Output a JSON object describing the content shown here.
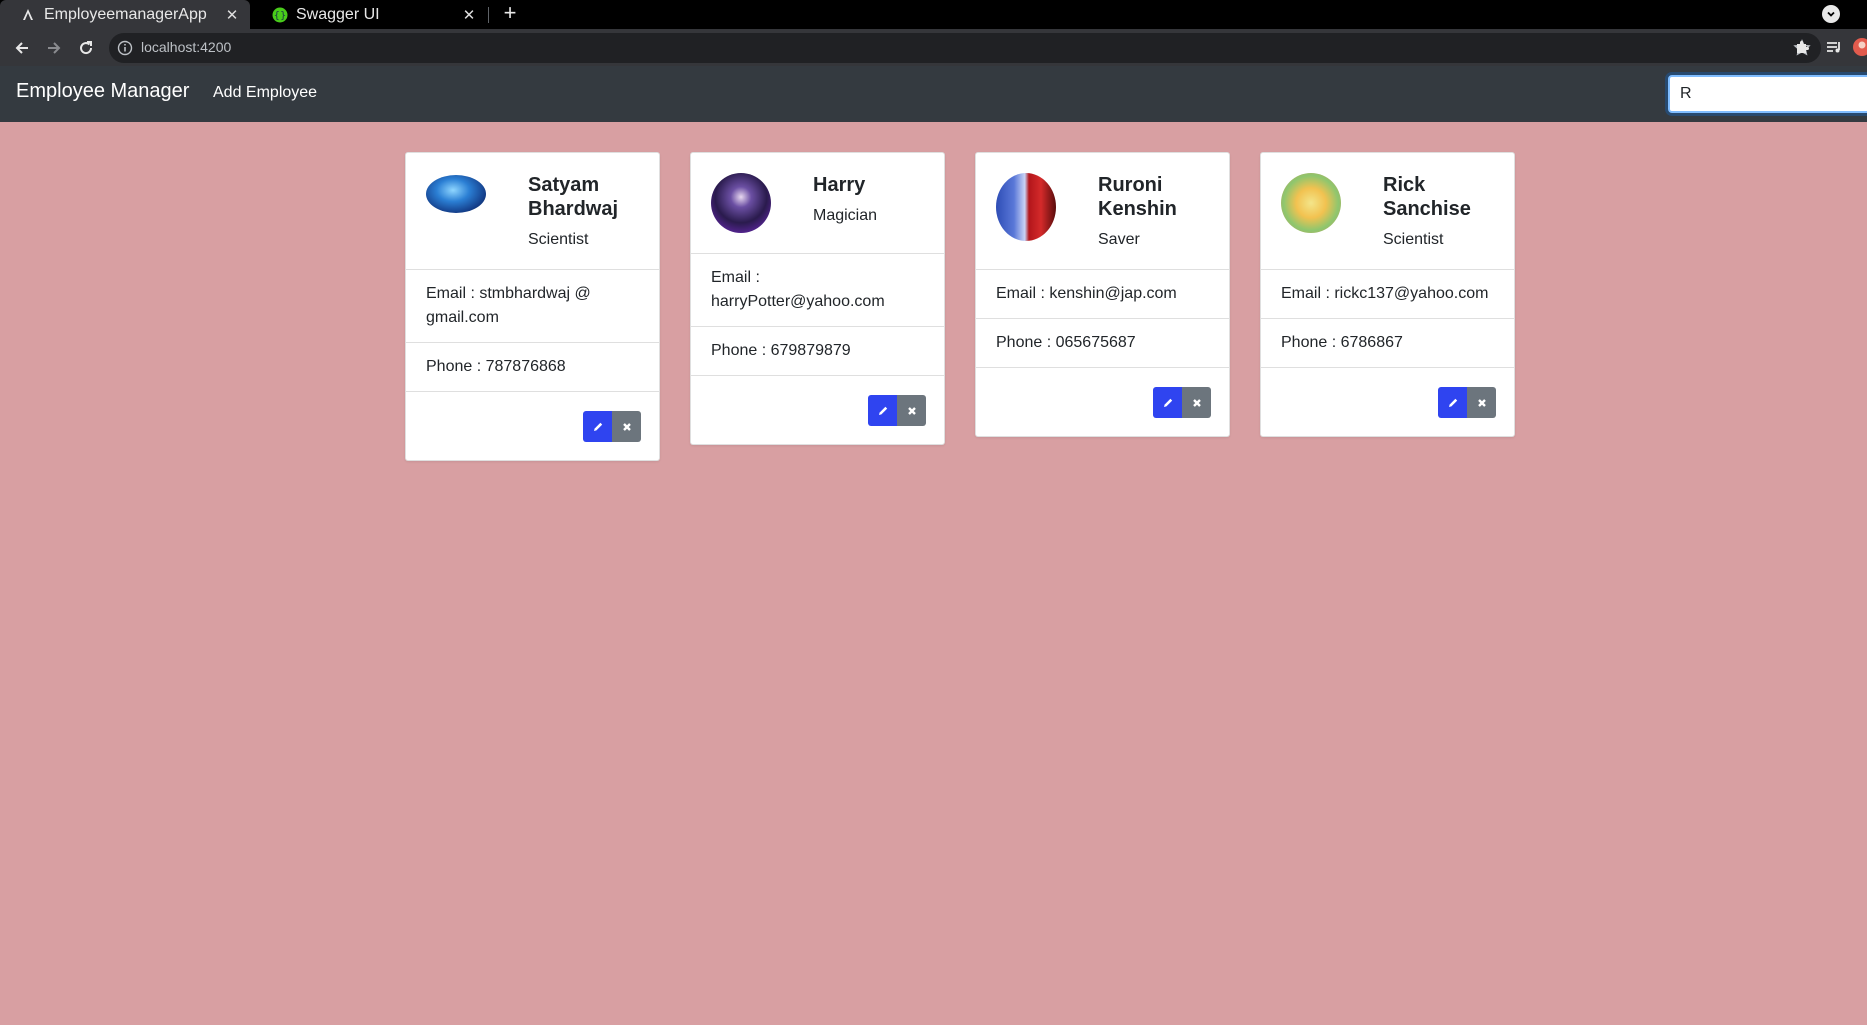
{
  "browser": {
    "tabs": [
      {
        "title": "EmployeemanagerApp",
        "icon": "angular-icon",
        "active": true
      },
      {
        "title": "Swagger UI",
        "icon": "swagger-icon",
        "active": false
      }
    ],
    "url": "localhost:4200"
  },
  "navbar": {
    "brand": "Employee Manager",
    "add_link": "Add Employee",
    "search_value": "R"
  },
  "colors": {
    "page_background": "#d89fa2",
    "navbar_background": "#343a40",
    "edit_button": "#2f44f0",
    "delete_button": "#6c757d"
  },
  "employees": [
    {
      "name": "Satyam Bhardwaj",
      "job_title": "Scientist",
      "email": "Email : stmbhardwaj @ gmail.com",
      "phone": "Phone : 787876868"
    },
    {
      "name": "Harry",
      "job_title": "Magician",
      "email": "Email : harryPotter@yahoo.com",
      "phone": "Phone : 679879879"
    },
    {
      "name": "Ruroni Kenshin",
      "job_title": "Saver",
      "email": "Email : kenshin@jap.com",
      "phone": "Phone : 065675687"
    },
    {
      "name": "Rick Sanchise",
      "job_title": "Scientist",
      "email": "Email : rickc137@yahoo.com",
      "phone": "Phone : 6786867"
    }
  ]
}
